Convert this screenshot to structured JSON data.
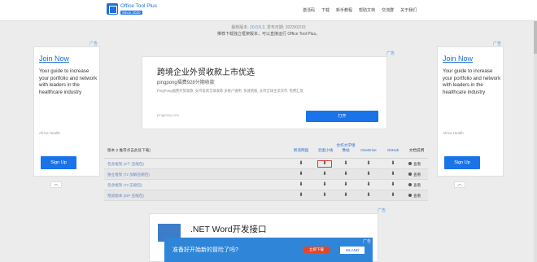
{
  "header": {
    "brand": "Office Tool Plus",
    "badge": "Since 2020",
    "nav": [
      "激活码",
      "下载",
      "新手教程",
      "帮助文档",
      "交流群",
      "关于我们"
    ]
  },
  "version": {
    "prefix": "最新版本:",
    "number": "10.0.5.2",
    "sep": ", 发布日期:",
    "date": "2023/02/15",
    "note": "推荐下载独立框架版本，可以直接运行 Office Tool Plus。"
  },
  "side_ad": {
    "ad_mark": "广告",
    "title": "Join Now",
    "text": "Your guide to increase your portfolio and network with leaders in the healthcare industry",
    "source": "Africa Health",
    "button": "Sign Up",
    "collapse": "︿"
  },
  "main_ad": {
    "ad_mark": "广告",
    "title": "跨境企业外贸收款上市优选",
    "subtitle": "pingpong福费928分期收款",
    "desc": "PingPong福费外贸收款, 支持电商全球收款 多账户通用, 快速到账, 支持全球主流货币, 免费汇款",
    "domain": "pingpong.com",
    "open": "打开"
  },
  "table": {
    "headers": {
      "version": "版本 (! 推荐点击此处下载)",
      "cols": [
        "新浪网盘",
        "云图小栈",
        "合作大学镜像站",
        "OneDrive",
        "GitHub",
        "文档说明"
      ]
    },
    "rows": [
      {
        "name": "包含框架 (3个 压缩包)",
        "view": "查看"
      },
      {
        "name": "独立框架 (7z 加解压缩包)",
        "view": "查看"
      },
      {
        "name": "包含框架 (7z 压缩包)",
        "view": "查看"
      },
      {
        "name": "预览版本 (ZIP 压缩包)",
        "view": "查看"
      }
    ]
  },
  "ad2": {
    "ad_mark": "广告",
    "title": ".NET Word开发接口"
  },
  "banner": {
    "text": "准备好开始新的冒险了吗?",
    "cta": "立即下载",
    "brand": "ISLAND",
    "ad_mark": "广告"
  },
  "colors": {
    "accent": "#1a73e8",
    "highlight": "#e53935",
    "link": "#1a6fd4"
  }
}
